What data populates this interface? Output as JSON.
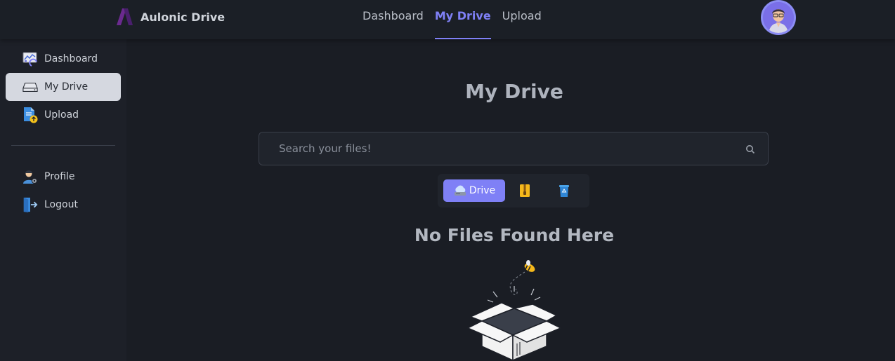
{
  "brand": {
    "name": "Aulonic Drive",
    "accent": "#7f80f6"
  },
  "topnav": [
    {
      "label": "Dashboard",
      "active": false
    },
    {
      "label": "My Drive",
      "active": true
    },
    {
      "label": "Upload",
      "active": false
    }
  ],
  "sidebar": {
    "items": [
      {
        "label": "Dashboard",
        "icon": "dashboard-icon"
      },
      {
        "label": "My Drive",
        "icon": "drive-icon",
        "active": true
      },
      {
        "label": "Upload",
        "icon": "upload-file-icon"
      },
      {
        "label": "Profile",
        "icon": "profile-icon"
      },
      {
        "label": "Logout",
        "icon": "logout-icon"
      }
    ]
  },
  "main": {
    "title": "My Drive",
    "search": {
      "placeholder": "Search your files!",
      "value": ""
    },
    "filters": [
      {
        "label": "Drive",
        "icon": "cloud-drive-icon",
        "active": true
      },
      {
        "label": "",
        "icon": "zip-archive-icon"
      },
      {
        "label": "",
        "icon": "recycle-bin-icon"
      }
    ],
    "empty_message": "No Files Found Here"
  }
}
